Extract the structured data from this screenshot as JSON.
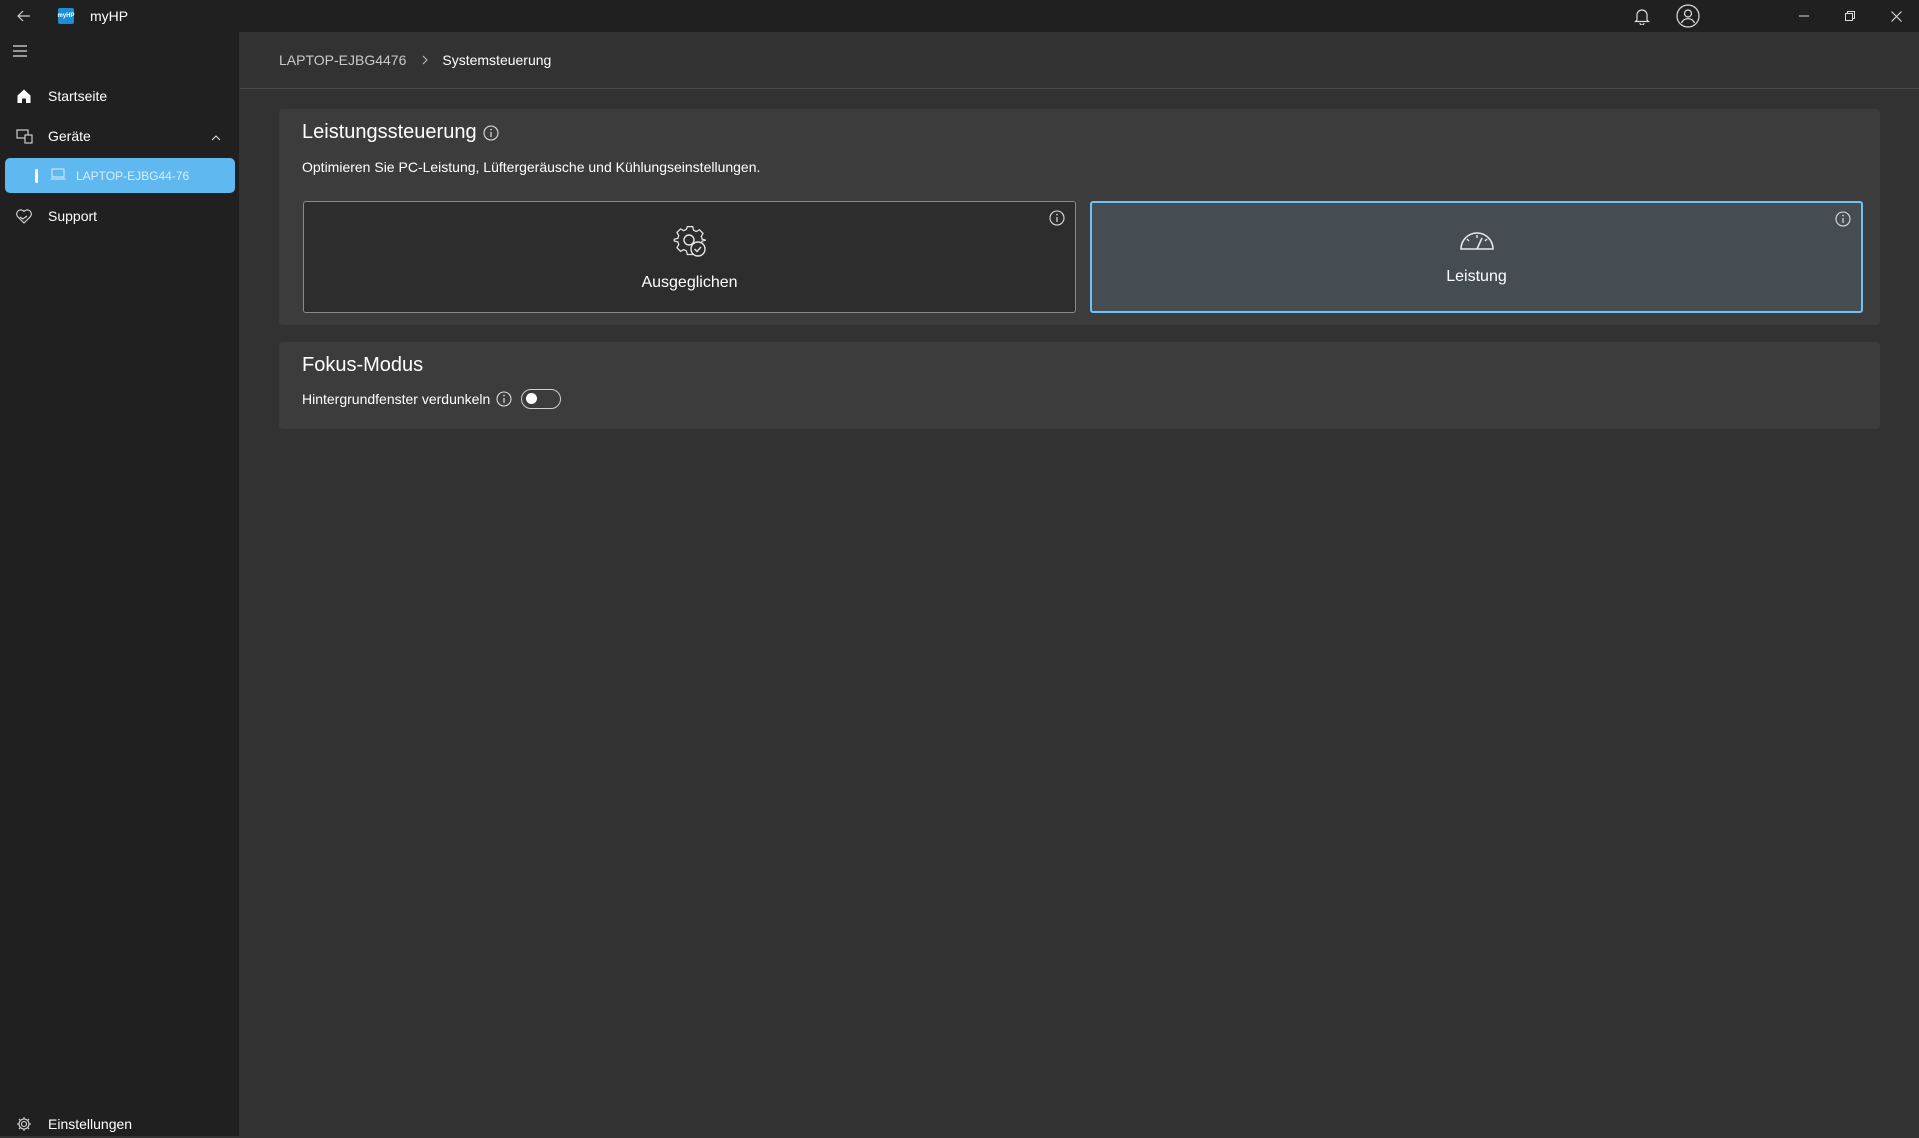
{
  "app": {
    "title": "myHP",
    "logo_text": "myHP"
  },
  "sidebar": {
    "items": [
      {
        "label": "Startseite"
      },
      {
        "label": "Geräte"
      },
      {
        "label": "Support"
      }
    ],
    "device": {
      "label": "LAPTOP-EJBG44-76"
    },
    "settings_label": "Einstellungen"
  },
  "breadcrumb": {
    "device": "LAPTOP-EJBG4476",
    "current": "Systemsteuerung"
  },
  "performance": {
    "title": "Leistungssteuerung",
    "description": "Optimieren Sie PC-Leistung, Lüftergeräusche und Kühlungseinstellungen.",
    "modes": [
      {
        "label": "Ausgeglichen",
        "icon": "gear-check-icon",
        "selected": false
      },
      {
        "label": "Leistung",
        "icon": "speedometer-icon",
        "selected": true
      }
    ]
  },
  "focus": {
    "title": "Fokus-Modus",
    "toggle_label": "Hintergrundfenster verdunkeln",
    "toggle_on": false
  },
  "colors": {
    "accent": "#6cc4f5",
    "sidebar_bg": "#202020",
    "content_bg": "#323232",
    "card_bg": "#3c3c3c"
  }
}
